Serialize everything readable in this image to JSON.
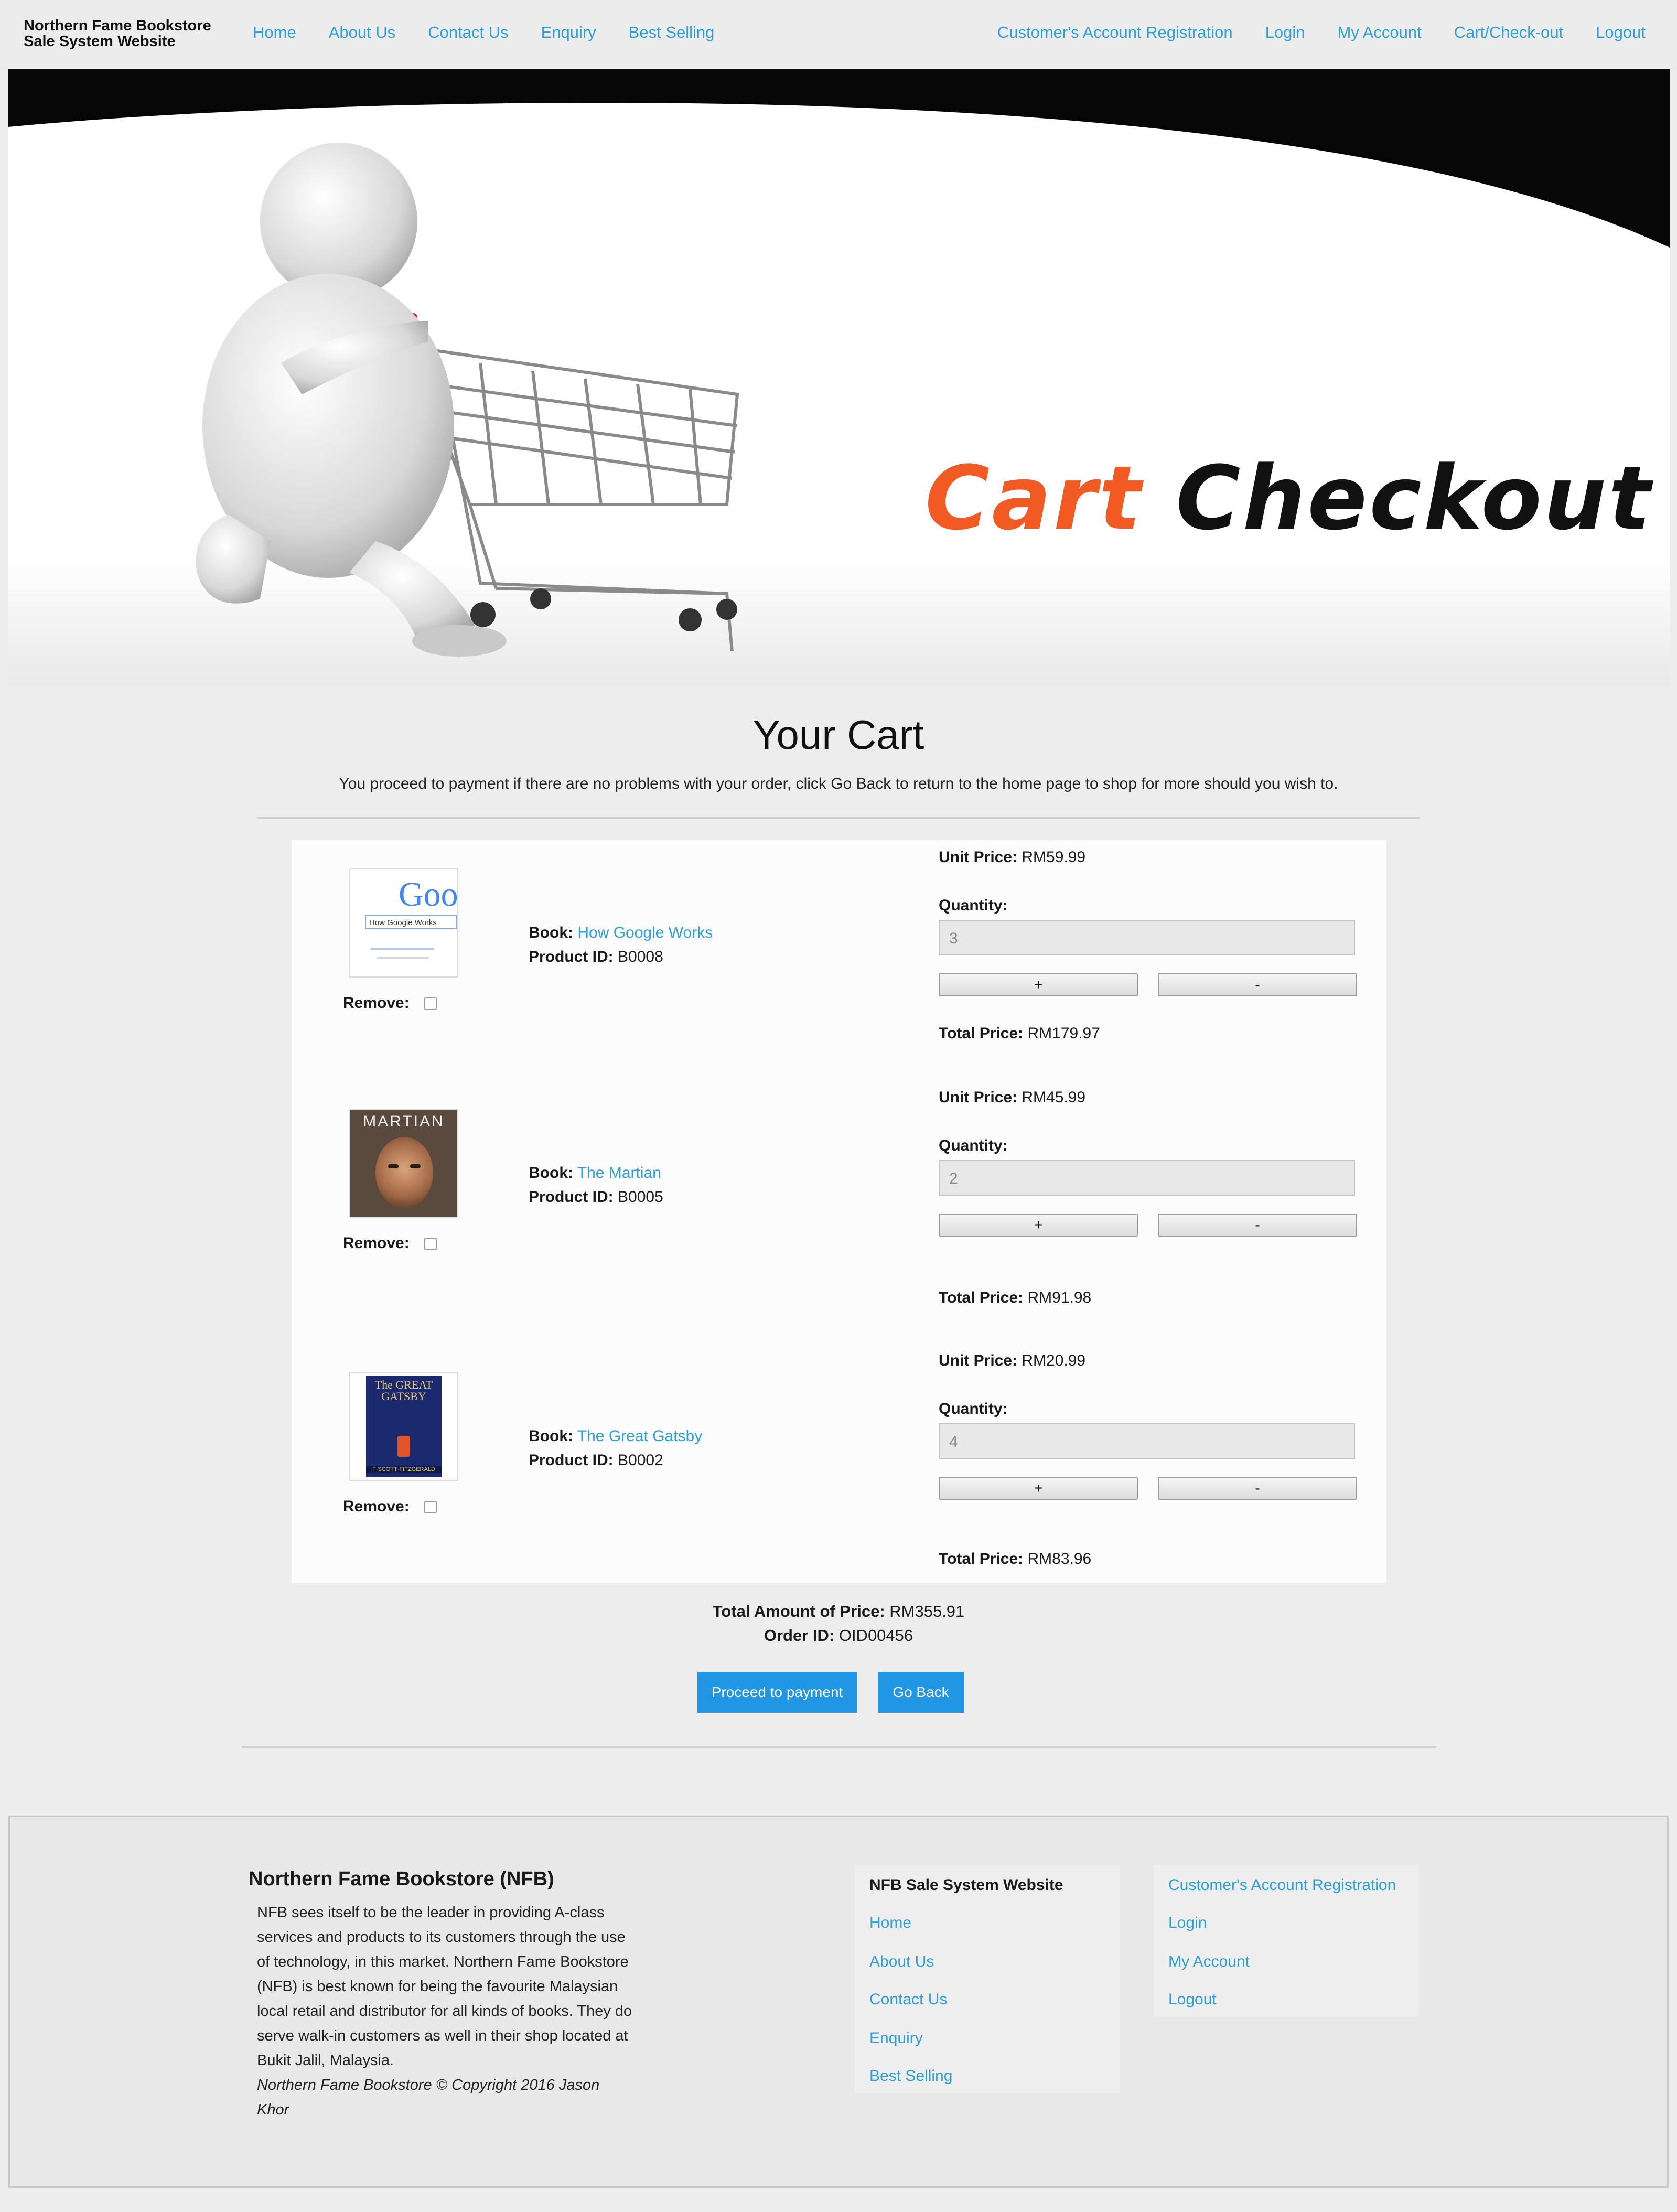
{
  "nav": {
    "brand_line1": "Northern Fame Bookstore",
    "brand_line2": "Sale System Website",
    "left": [
      "Home",
      "About Us",
      "Contact Us",
      "Enquiry",
      "Best Selling"
    ],
    "right": [
      "Customer's Account Registration",
      "Login",
      "My Account",
      "Cart/Check-out",
      "Logout"
    ]
  },
  "hero": {
    "title_part1": "Cart",
    "title_part2": "Checkout",
    "accent_color": "#f15a22"
  },
  "cart": {
    "title": "Your Cart",
    "intro": "You proceed to payment if there are no problems with your order, click Go Back to return to the home page to shop for more should you wish to.",
    "labels": {
      "remove": "Remove:",
      "book": "Book:",
      "product_id": "Product ID:",
      "unit_price": "Unit Price:",
      "quantity": "Quantity:",
      "total_price": "Total Price:",
      "plus": "+",
      "minus": "-"
    },
    "items": [
      {
        "book": "How Google Works",
        "product_id": "B0008",
        "unit_price": "RM59.99",
        "quantity": "3",
        "total_price": "RM179.97",
        "cover_text_1": "Goo",
        "cover_text_2": "How Google Works"
      },
      {
        "book": "The Martian",
        "product_id": "B0005",
        "unit_price": "RM45.99",
        "quantity": "2",
        "total_price": "RM91.98",
        "cover_text_1": "MARTIAN"
      },
      {
        "book": "The Great Gatsby",
        "product_id": "B0002",
        "unit_price": "RM20.99",
        "quantity": "4",
        "total_price": "RM83.96",
        "cover_text_1": "The GREAT",
        "cover_text_2": "GATSBY",
        "cover_text_3": "F·SCOTT·FITZGERALD"
      }
    ]
  },
  "summary": {
    "total_label": "Total Amount of Price:",
    "total_value": "RM355.91",
    "order_label": "Order ID:",
    "order_value": "OID00456",
    "proceed_button": "Proceed to payment",
    "back_button": "Go Back",
    "button_color": "#2196e3"
  },
  "footer": {
    "title": "Northern Fame Bookstore (NFB)",
    "text": "NFB sees itself to be the leader in providing A-class services and products to its customers through the use of technology, in this market. Northern Fame Bookstore (NFB) is best known for being the favourite Malaysian local retail and distributor for all kinds of books. They do serve walk-in customers as well in their shop located at Bukit Jalil, Malaysia.",
    "copyright": "Northern Fame Bookstore © Copyright 2016 Jason Khor",
    "col1_heading": "NFB Sale System Website",
    "col1_links": [
      "Home",
      "About Us",
      "Contact Us",
      "Enquiry",
      "Best Selling"
    ],
    "col2_links": [
      "Customer's Account Registration",
      "Login",
      "My Account",
      "Logout"
    ]
  }
}
